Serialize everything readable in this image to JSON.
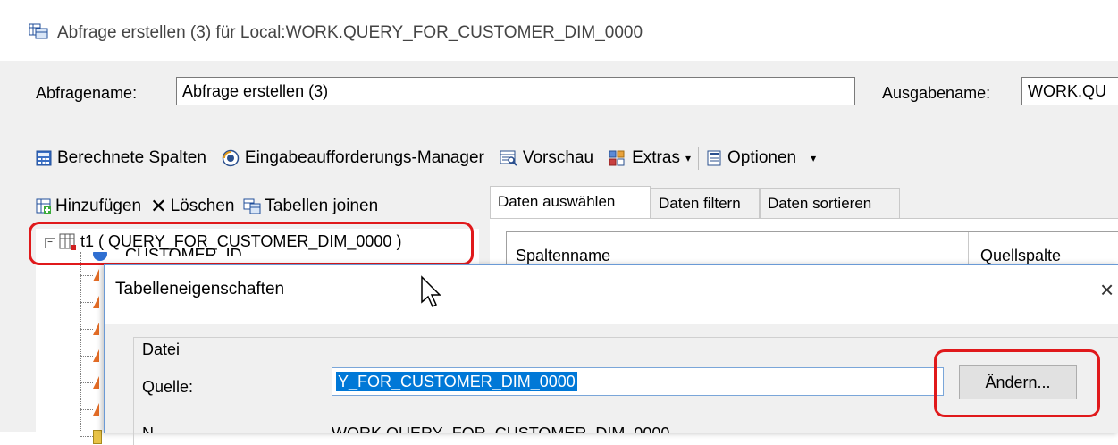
{
  "outer": {
    "title": "Abfrage erstellen (3) für Local:WORK.QUERY_FOR_CUSTOMER_DIM_0000",
    "query_name_label": "Abfragename:",
    "query_name_value": "Abfrage erstellen (3)",
    "output_name_label": "Ausgabename:",
    "output_name_value": "WORK.QU"
  },
  "toolbar": {
    "computed_columns": "Berechnete Spalten",
    "prompt_manager": "Eingabeaufforderungs-Manager",
    "preview": "Vorschau",
    "extras": "Extras",
    "options": "Optionen"
  },
  "left_panel": {
    "add": "Hinzufügen",
    "delete": "Löschen",
    "join": "Tabellen joinen",
    "tree_root": "t1 ( QUERY_FOR_CUSTOMER_DIM_0000 )",
    "tree_child_partial": "CUSTOMER_ID"
  },
  "tabs": [
    "Daten auswählen",
    "Daten filtern",
    "Daten sortieren"
  ],
  "grid": {
    "col1": "Spaltenname",
    "col2": "Quellspalte"
  },
  "dialog": {
    "title": "Tabelleneigenschaften",
    "close_glyph": "×",
    "group_label": "Datei",
    "source_label": "Quelle:",
    "source_value": "Y_FOR_CUSTOMER_DIM_0000",
    "change_button": "Ändern...",
    "name_label_partial": "N",
    "name_value_partial": "WORK.QUERY_FOR_CUSTOMER_DIM_0000"
  },
  "colors": {
    "highlight_red": "#e0191b",
    "selection_blue": "#0078d7"
  }
}
